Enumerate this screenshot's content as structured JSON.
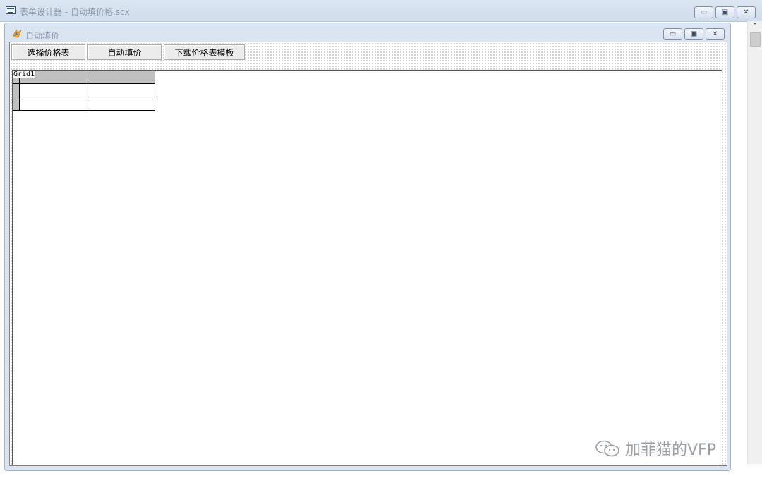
{
  "outer_window": {
    "title": "表单设计器 - 自动填价格.scx",
    "buttons": {
      "minimize": "▭",
      "restore": "▣",
      "close": "✕"
    }
  },
  "form_window": {
    "title": "自动填价",
    "buttons": {
      "minimize": "▭",
      "restore": "▣",
      "close": "✕"
    },
    "toolbar": {
      "select_price_table": "选择价格表",
      "auto_fill_price": "自动填价",
      "download_template": "下载价格表模板"
    },
    "grid": {
      "name": "Grid1",
      "columns": [
        "",
        ""
      ],
      "rows": [
        [
          "",
          ""
        ],
        [
          "",
          ""
        ]
      ]
    }
  },
  "watermark": {
    "text": "加菲猫的VFP"
  },
  "colors": {
    "title_bg": "#dce6f2",
    "form_bg": "#dbe5f1",
    "grid_header": "#c0c0c0"
  }
}
